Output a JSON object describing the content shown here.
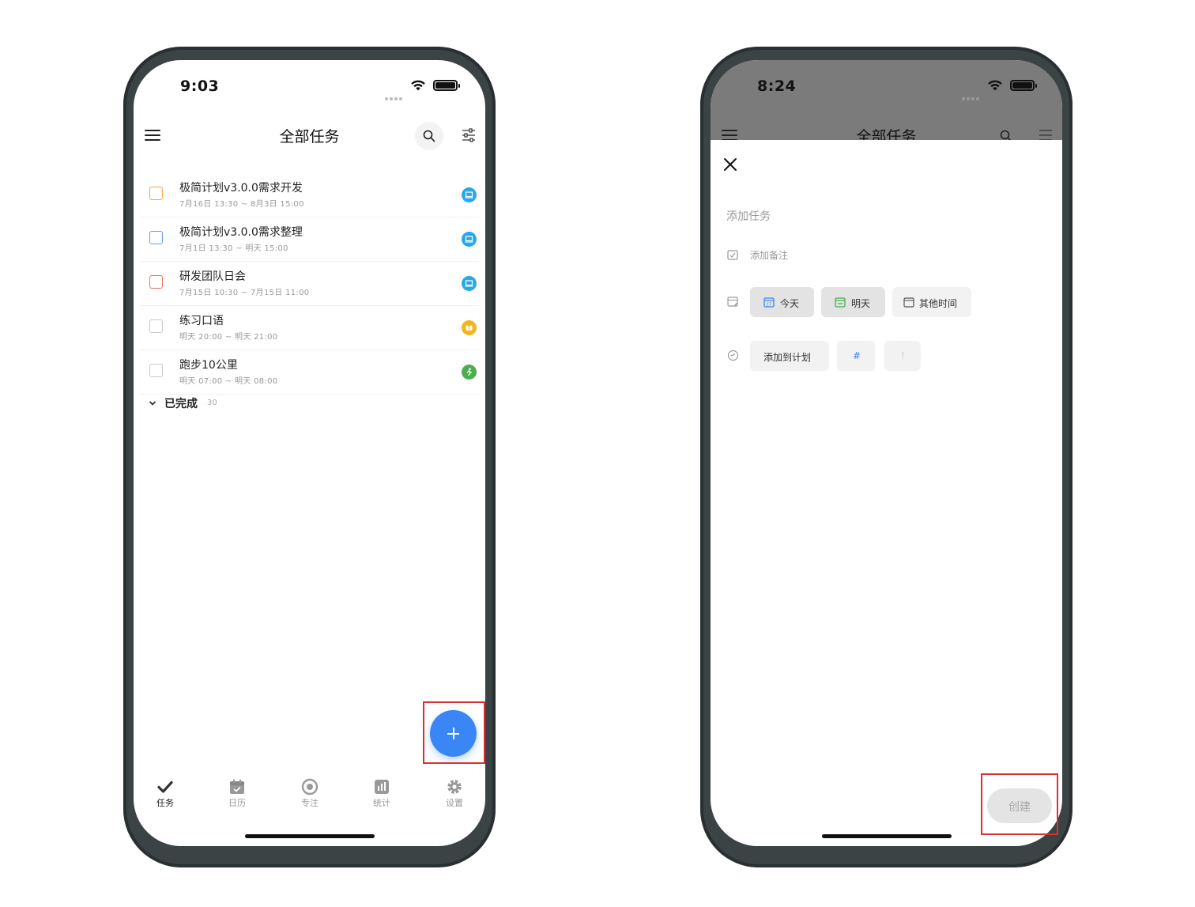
{
  "left_phone": {
    "status": {
      "time": "9:03"
    },
    "header": {
      "title": "全部任务"
    },
    "tasks": [
      {
        "name": "极简计划v3.0.0需求开发",
        "time": "7月16日 13:30 ~ 8月3日 15:00",
        "checkbox_color": "#f0a94a",
        "tag_color": "#29a8e8",
        "tag_icon": "laptop-icon"
      },
      {
        "name": "极简计划v3.0.0需求整理",
        "time": "7月1日 13:30 ~ 明天 15:00",
        "checkbox_color": "#5aa0e8",
        "tag_color": "#29a8e8",
        "tag_icon": "laptop-icon"
      },
      {
        "name": "研发团队日会",
        "time": "7月15日 10:30 ~ 7月15日 11:00",
        "checkbox_color": "#e2775f",
        "tag_color": "#29a8e8",
        "tag_icon": "laptop-icon"
      },
      {
        "name": "练习口语",
        "time": "明天 20:00 ~ 明天 21:00",
        "checkbox_color": "#c8c8c8",
        "tag_color": "#f2b61d",
        "tag_icon": "book-icon"
      },
      {
        "name": "跑步10公里",
        "time": "明天 07:00 ~ 明天 08:00",
        "checkbox_color": "#c8c8c8",
        "tag_color": "#4cae4f",
        "tag_icon": "runner-icon"
      }
    ],
    "completed": {
      "label": "已完成",
      "count": "30"
    },
    "nav": [
      {
        "label": "任务",
        "icon": "check-icon",
        "active": true
      },
      {
        "label": "日历",
        "icon": "calendar-icon",
        "active": false
      },
      {
        "label": "专注",
        "icon": "focus-icon",
        "active": false
      },
      {
        "label": "统计",
        "icon": "chart-icon",
        "active": false
      },
      {
        "label": "设置",
        "icon": "gear-icon",
        "active": false
      }
    ]
  },
  "right_phone": {
    "status": {
      "time": "8:24"
    },
    "header": {
      "title": "全部任务"
    },
    "sheet": {
      "title_placeholder": "添加任务",
      "note_placeholder": "添加备注",
      "date_options": [
        {
          "label": "今天",
          "icon": "calendar-today-icon",
          "selected": true
        },
        {
          "label": "明天",
          "icon": "calendar-tomorrow-icon",
          "selected": true
        },
        {
          "label": "其他时间",
          "icon": "calendar-other-icon",
          "selected": false
        }
      ],
      "plan_button": "添加到计划",
      "tag_button": "#",
      "priority_button": "!",
      "create_button": "创建"
    }
  },
  "colors": {
    "accent": "#3a86f5",
    "highlight": "#d63234"
  }
}
